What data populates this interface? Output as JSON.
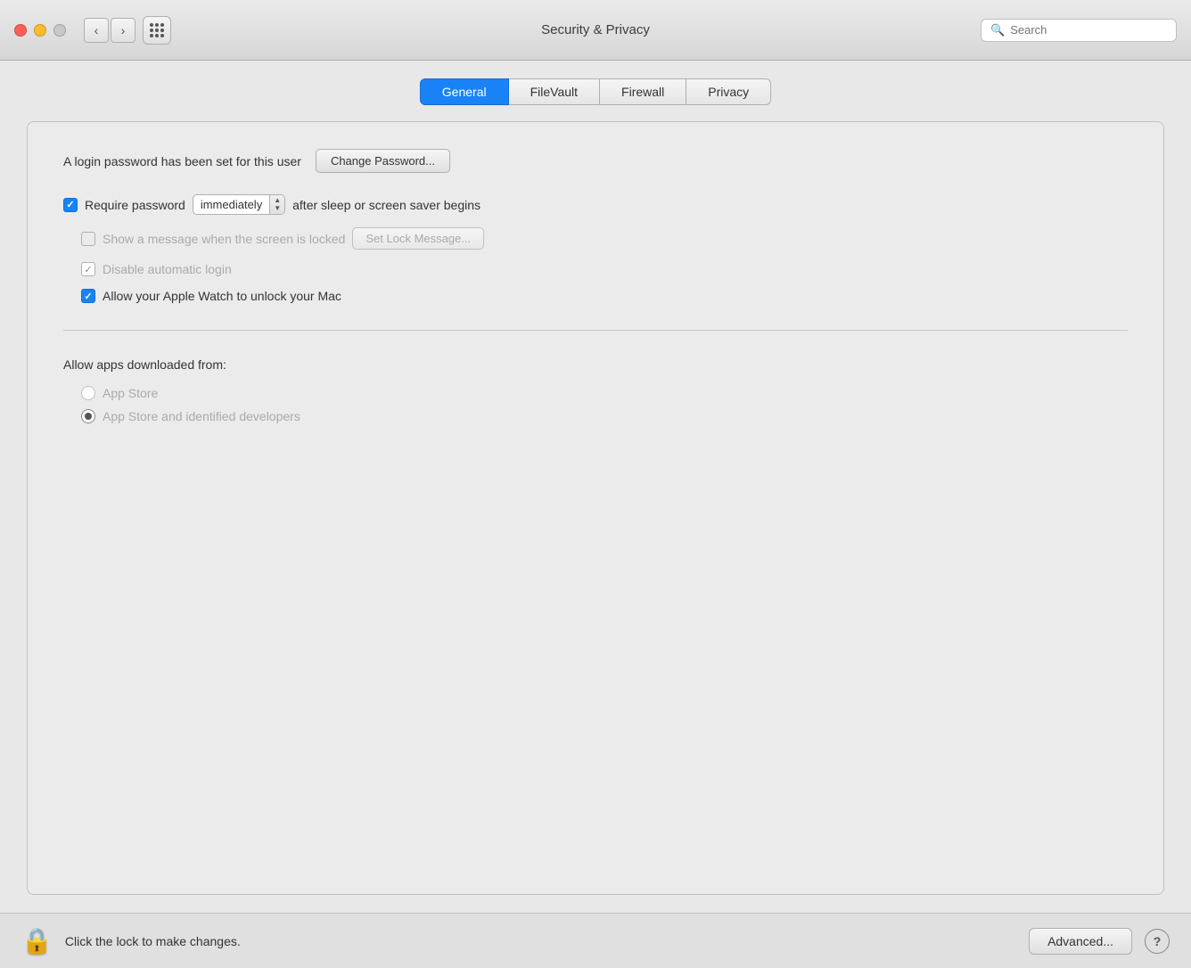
{
  "titlebar": {
    "title": "Security & Privacy",
    "back_label": "‹",
    "forward_label": "›"
  },
  "search": {
    "placeholder": "Search"
  },
  "tabs": [
    {
      "id": "general",
      "label": "General",
      "active": true
    },
    {
      "id": "filevault",
      "label": "FileVault",
      "active": false
    },
    {
      "id": "firewall",
      "label": "Firewall",
      "active": false
    },
    {
      "id": "privacy",
      "label": "Privacy",
      "active": false
    }
  ],
  "general": {
    "password_label": "A login password has been set for this user",
    "change_password_btn": "Change Password...",
    "require_password_label": "Require password",
    "require_password_dropdown_value": "immediately",
    "require_password_suffix": "after sleep or screen saver begins",
    "show_message_label": "Show a message when the screen is locked",
    "set_lock_message_btn": "Set Lock Message...",
    "disable_autologin_label": "Disable automatic login",
    "apple_watch_label": "Allow your Apple Watch to unlock your Mac",
    "allow_apps_label": "Allow apps downloaded from:",
    "radio_appstore_label": "App Store",
    "radio_appstore_identified_label": "App Store and identified developers"
  },
  "bottom": {
    "lock_text": "Click the lock to make changes.",
    "advanced_btn": "Advanced...",
    "help_btn": "?"
  },
  "state": {
    "require_password_checked": true,
    "show_message_checked": false,
    "disable_autologin_checked": true,
    "apple_watch_checked": true,
    "appstore_selected": false,
    "appstore_identified_selected": true
  }
}
